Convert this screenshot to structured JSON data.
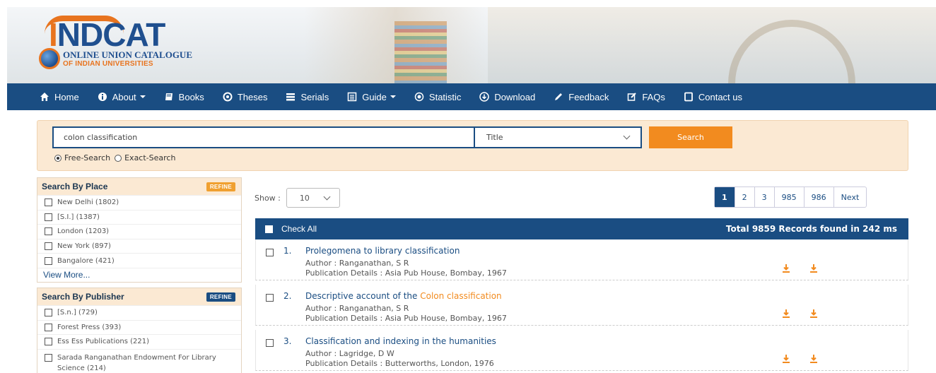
{
  "header": {
    "logo": {
      "name": "INDCAT",
      "subtitle_line1": "ONLINE UNION CATALOGUE",
      "subtitle_line2": "OF INDIAN UNIVERSITIES"
    }
  },
  "nav": {
    "items": [
      {
        "label": "Home",
        "icon": "home-icon",
        "dropdown": false
      },
      {
        "label": "About",
        "icon": "info-icon",
        "dropdown": true
      },
      {
        "label": "Books",
        "icon": "book-icon",
        "dropdown": false
      },
      {
        "label": "Theses",
        "icon": "target-icon",
        "dropdown": false
      },
      {
        "label": "Serials",
        "icon": "list-icon",
        "dropdown": false
      },
      {
        "label": "Guide",
        "icon": "guide-icon",
        "dropdown": true
      },
      {
        "label": "Statistic",
        "icon": "stats-icon",
        "dropdown": false
      },
      {
        "label": "Download",
        "icon": "download-icon",
        "dropdown": false
      },
      {
        "label": "Feedback",
        "icon": "pencil-icon",
        "dropdown": false
      },
      {
        "label": "FAQs",
        "icon": "edit-icon",
        "dropdown": false
      },
      {
        "label": "Contact us",
        "icon": "contact-icon",
        "dropdown": false
      }
    ]
  },
  "search": {
    "query": "colon classification",
    "field_selected": "Title",
    "button_label": "Search",
    "modes": [
      {
        "label": "Free-Search",
        "selected": true
      },
      {
        "label": "Exact-Search",
        "selected": false
      }
    ]
  },
  "facets": {
    "place": {
      "title": "Search By Place",
      "refine_label": "REFINE",
      "items": [
        "New Delhi (1802)",
        "[S.I.] (1387)",
        "London (1203)",
        "New York (897)",
        "Bangalore (421)"
      ],
      "view_more": "View More..."
    },
    "publisher": {
      "title": "Search By Publisher",
      "refine_label": "REFINE",
      "items": [
        "[S.n.] (729)",
        "Forest Press (393)",
        "Ess Ess Publications (221)",
        "Sarada Ranganathan Endowment For Library Science (214)"
      ]
    }
  },
  "results": {
    "show_label": "Show :",
    "page_size": "10",
    "pagination": [
      "1",
      "2",
      "3",
      "985",
      "986",
      "Next"
    ],
    "active_page": "1",
    "check_all_label": "Check All",
    "total_text": "Total 9859 Records found in 242 ms",
    "records": [
      {
        "num": "1.",
        "title_pre": "Prolegomena to library classification",
        "title_hl": "",
        "author": "Author : Ranganathan, S R",
        "publication": "Publication Details : Asia Pub House, Bombay, 1967"
      },
      {
        "num": "2.",
        "title_pre": "Descriptive account of the ",
        "title_hl": "Colon classification",
        "author": "Author : Ranganathan, S R",
        "publication": "Publication Details : Asia Pub House, Bombay, 1967"
      },
      {
        "num": "3.",
        "title_pre": "Classification and indexing in the humanities",
        "title_hl": "",
        "author": "Author : Lagridge, D W",
        "publication": "Publication Details : Butterworths, London, 1976"
      }
    ]
  },
  "colors": {
    "primary": "#1a4d82",
    "accent": "#f28b1f",
    "panel": "#fbe9d3"
  }
}
